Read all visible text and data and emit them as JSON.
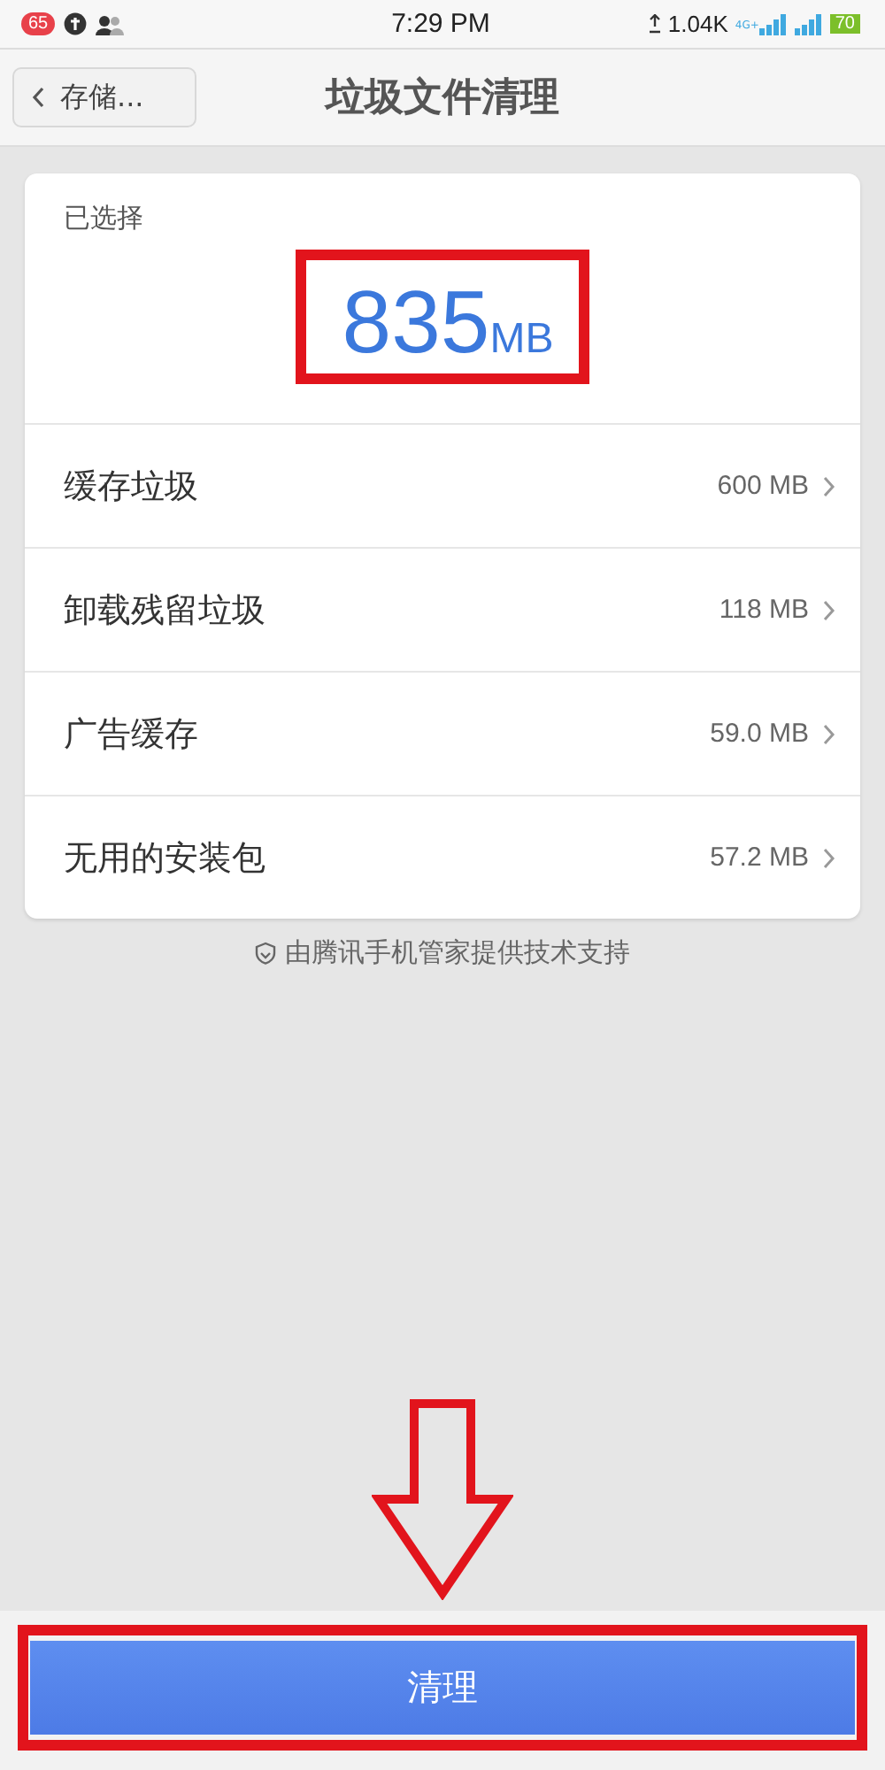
{
  "status_bar": {
    "notification_count": "65",
    "time": "7:29 PM",
    "net_speed": "1.04K",
    "network_type": "4G+",
    "battery": "70"
  },
  "header": {
    "back_label": "存储...",
    "title": "垃圾文件清理"
  },
  "summary": {
    "label": "已选择",
    "amount": "835",
    "unit": "MB",
    "highlighted": true
  },
  "items": [
    {
      "name": "缓存垃圾",
      "size": "600 MB"
    },
    {
      "name": "卸载残留垃圾",
      "size": "118 MB"
    },
    {
      "name": "广告缓存",
      "size": "59.0 MB"
    },
    {
      "name": "无用的安装包",
      "size": "57.2 MB"
    }
  ],
  "credit": "由腾讯手机管家提供技术支持",
  "clean_button": {
    "label": "清理",
    "highlighted": true
  }
}
